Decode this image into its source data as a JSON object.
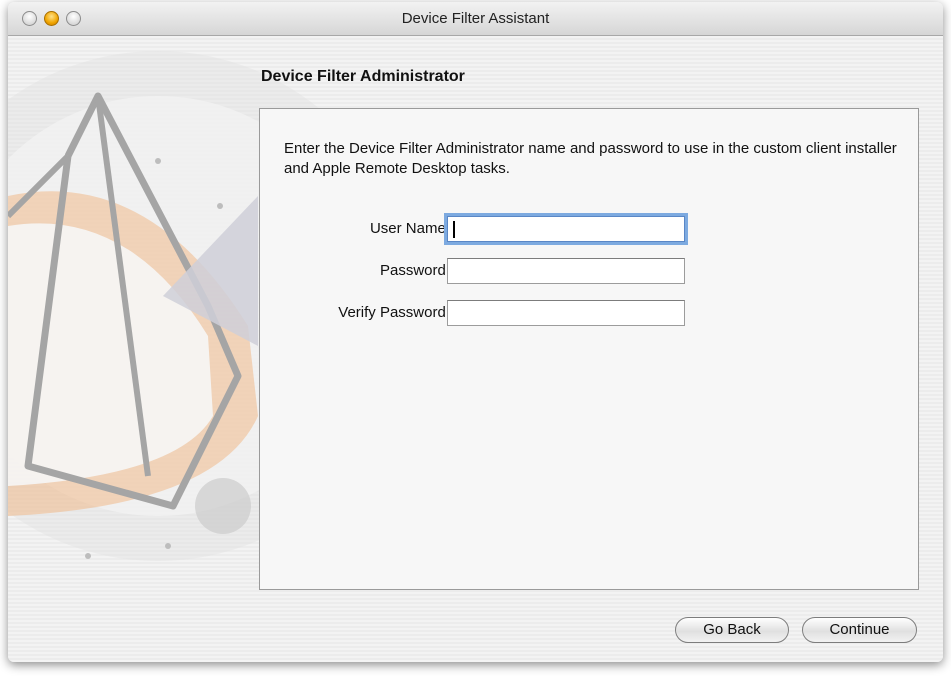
{
  "window": {
    "title": "Device Filter Assistant"
  },
  "page": {
    "heading": "Device Filter Administrator",
    "description": "Enter the Device Filter Administrator name and password to use in the custom client installer and Apple Remote Desktop tasks."
  },
  "form": {
    "user_name_label": "User Name:",
    "user_name_value": "",
    "password_label": "Password:",
    "password_value": "",
    "verify_password_label": "Verify Password:",
    "verify_password_value": ""
  },
  "buttons": {
    "go_back": "Go Back",
    "continue": "Continue"
  },
  "colors": {
    "focus_ring": "#7daae0",
    "art_orange": "#f0b98a",
    "traffic_light_minimize": "#f0a500"
  }
}
